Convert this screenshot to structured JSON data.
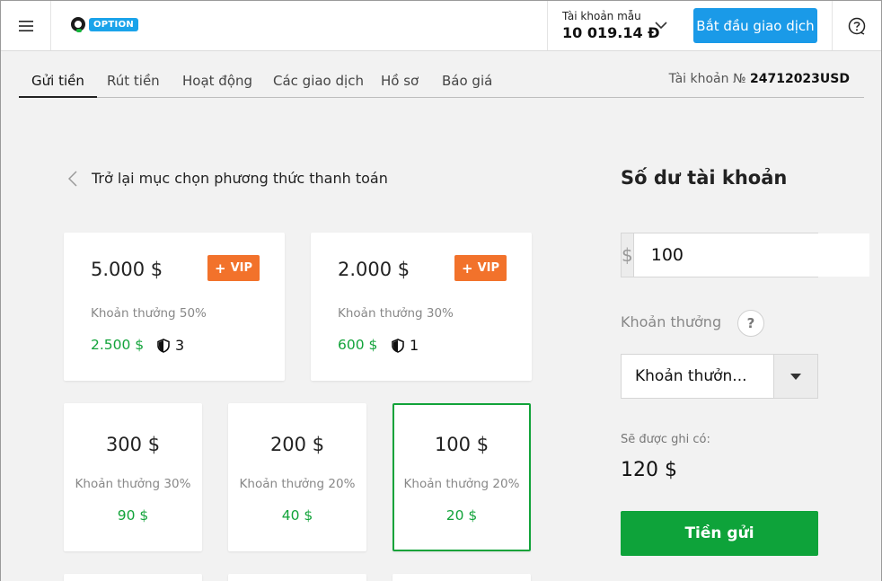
{
  "header": {
    "logo_text": "OPTION",
    "account_label": "Tài khoản mẫu",
    "account_value": "10 019.14 Đ",
    "trade_button": "Bắt đầu giao dịch",
    "help_icon": "question-circle-icon",
    "colors": {
      "accent": "#1a9ae8",
      "logo_green": "#12b53a"
    }
  },
  "tabs": [
    {
      "label": "Gửi tiền",
      "active": true
    },
    {
      "label": "Rút tiền"
    },
    {
      "label": "Hoạt động"
    },
    {
      "label": "Các giao dịch"
    },
    {
      "label": "Hồ sơ"
    },
    {
      "label": "Báo giá"
    }
  ],
  "account_number": {
    "label": "Tài khoản №",
    "value": "24712023USD"
  },
  "back_link": "Trở lại mục chọn phương thức thanh toán",
  "cards": [
    {
      "amount": "5.000 $",
      "bonus": "Khoản thưởng 50%",
      "reward": "2.500 $",
      "vip": "VIP",
      "shield_count": "3"
    },
    {
      "amount": "2.000 $",
      "bonus": "Khoản thưởng 30%",
      "reward": "600 $",
      "vip": "VIP",
      "shield_count": "1"
    },
    {
      "amount": "300 $",
      "bonus": "Khoản thưởng 30%",
      "reward": "90 $"
    },
    {
      "amount": "200 $",
      "bonus": "Khoản thưởng 20%",
      "reward": "40 $"
    },
    {
      "amount": "100 $",
      "bonus": "Khoản thưởng 20%",
      "reward": "20 $",
      "selected": true
    }
  ],
  "sidebar": {
    "title": "Số dư tài khoản",
    "currency_symbol": "$",
    "amount_value": "100",
    "bonus_label": "Khoản thưởng",
    "bonus_help": "?",
    "bonus_selected": "Khoản thưởn...",
    "credited_label": "Sẽ được ghi có:",
    "credited_value": "120 $",
    "deposit_button": "Tiền gửi",
    "colors": {
      "success": "#0ea33a",
      "vip": "#f2722b"
    }
  }
}
